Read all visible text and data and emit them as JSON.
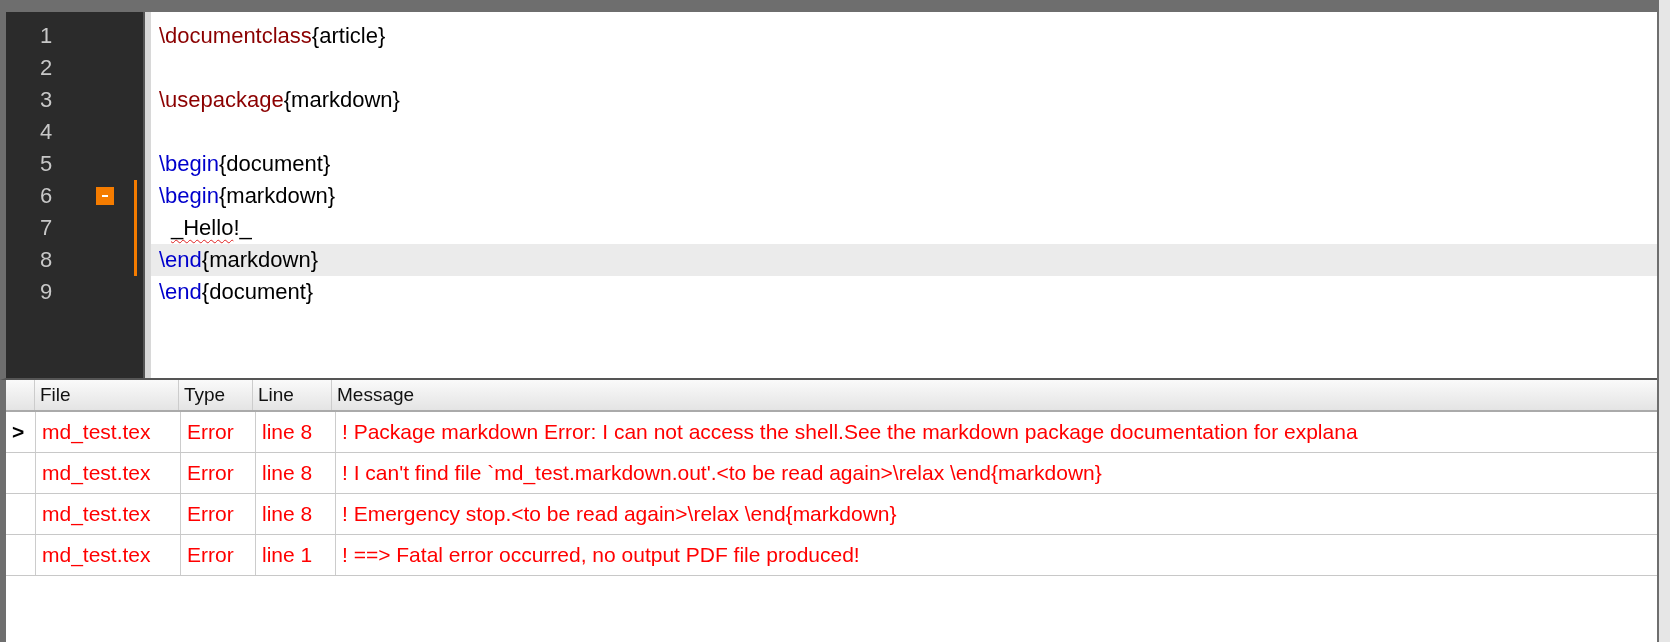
{
  "editor": {
    "lines": [
      {
        "number": "1",
        "current": false,
        "fold_start": false,
        "in_fold": false,
        "tokens": [
          {
            "kind": "command",
            "text": "\\documentclass"
          },
          {
            "kind": "text",
            "text": "{article}"
          }
        ]
      },
      {
        "number": "2",
        "current": false,
        "fold_start": false,
        "in_fold": false
      },
      {
        "number": "3",
        "current": false,
        "fold_start": false,
        "in_fold": false,
        "tokens": [
          {
            "kind": "command",
            "text": "\\usepackage"
          },
          {
            "kind": "text",
            "text": "{markdown}"
          }
        ]
      },
      {
        "number": "4",
        "current": false,
        "fold_start": false,
        "in_fold": false
      },
      {
        "number": "5",
        "current": false,
        "fold_start": false,
        "in_fold": false,
        "tokens": [
          {
            "kind": "environment",
            "text": "\\begin"
          },
          {
            "kind": "text",
            "text": "{document}"
          }
        ]
      },
      {
        "number": "6",
        "current": false,
        "fold_start": true,
        "in_fold": true,
        "tokens": [
          {
            "kind": "environment",
            "text": "\\begin"
          },
          {
            "kind": "text",
            "text": "{markdown}"
          }
        ]
      },
      {
        "number": "7",
        "current": false,
        "fold_start": false,
        "in_fold": true,
        "indented": true,
        "tokens": [
          {
            "kind": "text",
            "text": "_Hello",
            "misspelled": true
          },
          {
            "kind": "text",
            "text": "!_"
          }
        ]
      },
      {
        "number": "8",
        "current": true,
        "fold_start": false,
        "in_fold": true,
        "tokens": [
          {
            "kind": "environment",
            "text": "\\end"
          },
          {
            "kind": "text",
            "text": "{markdown}"
          }
        ]
      },
      {
        "number": "9",
        "current": false,
        "fold_start": false,
        "in_fold": false,
        "tokens": [
          {
            "kind": "environment",
            "text": "\\end"
          },
          {
            "kind": "text",
            "text": "{document}"
          }
        ]
      }
    ]
  },
  "log_table": {
    "columns": [
      "File",
      "Type",
      "Line",
      "Message"
    ],
    "marker": ">",
    "rows": [
      {
        "selected": true,
        "file": "md_test.tex",
        "type": "Error",
        "line": "line 8",
        "message": "! Package markdown Error: I can not access the shell.See the markdown package documentation for explana"
      },
      {
        "selected": false,
        "file": "md_test.tex",
        "type": "Error",
        "line": "line 8",
        "message": "! I can't find file `md_test.markdown.out'.<to be read again>\\relax \\end{markdown}"
      },
      {
        "selected": false,
        "file": "md_test.tex",
        "type": "Error",
        "line": "line 8",
        "message": "! Emergency stop.<to be read again>\\relax \\end{markdown}"
      },
      {
        "selected": false,
        "file": "md_test.tex",
        "type": "Error",
        "line": "line 1",
        "message": "! ==> Fatal error occurred, no output PDF file produced!"
      }
    ]
  }
}
